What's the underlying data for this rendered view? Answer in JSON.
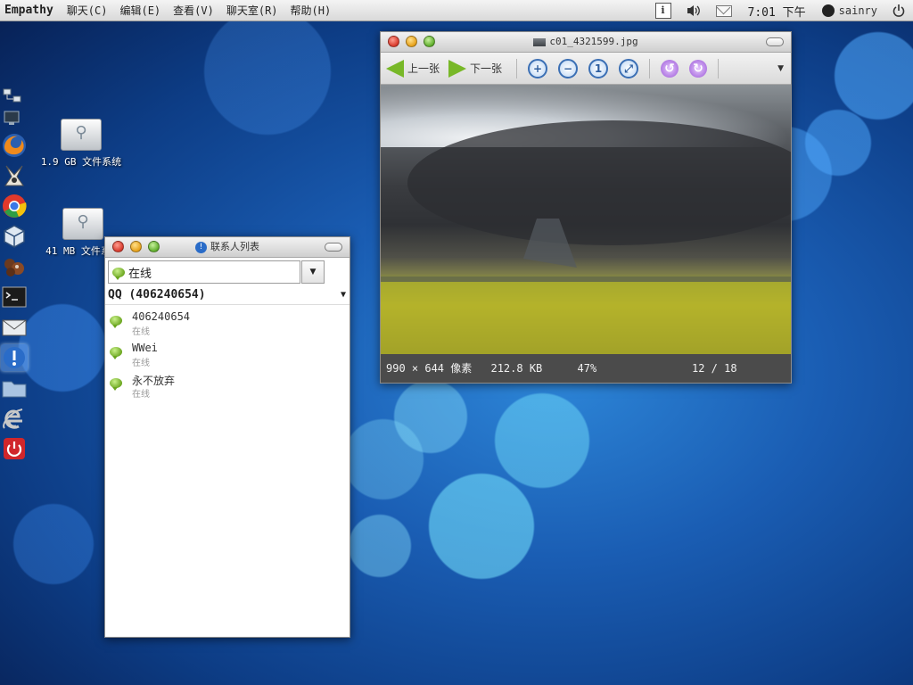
{
  "top_panel": {
    "app_name": "Empathy",
    "menus": [
      "聊天(C)",
      "编辑(E)",
      "查看(V)",
      "聊天室(R)",
      "帮助(H)"
    ],
    "tray": {
      "info_icon_label": "i"
    },
    "clock": "7:01 下午",
    "username": "sainry"
  },
  "dock": {
    "items": [
      "network-icon",
      "display-icon",
      "firefox-icon",
      "inkscape-icon",
      "chrome-icon",
      "virtualbox-icon",
      "chocolate-icon",
      "terminal-icon",
      "mail-icon",
      "info-icon",
      "folder-icon",
      "ie-icon",
      "power-icon"
    ]
  },
  "desktop": {
    "icons": [
      {
        "label": "1.9 GB 文件系统"
      },
      {
        "label": "41 MB 文件系统"
      }
    ]
  },
  "image_viewer": {
    "title": "c01_4321599.jpg",
    "toolbar": {
      "prev_label": "上一张",
      "next_label": "下一张"
    },
    "status": {
      "dimensions": "990 × 644 像素",
      "size": "212.8 KB",
      "zoom": "47%",
      "position": "12 / 18"
    }
  },
  "contact_list": {
    "title": "联系人列表",
    "status_selector": {
      "value": "在线"
    },
    "account": {
      "label": "QQ (406240654)"
    },
    "contacts": [
      {
        "name": "406240654",
        "status": "在线"
      },
      {
        "name": "WWei",
        "status": "在线"
      },
      {
        "name": "永不放弃",
        "status": "在线"
      }
    ]
  },
  "colors": {
    "desktop_bg": "#1a5db3",
    "status_bar_bg": "#4b4b4b",
    "online_green": "#6aa51f",
    "arrow_green": "#78b828"
  }
}
